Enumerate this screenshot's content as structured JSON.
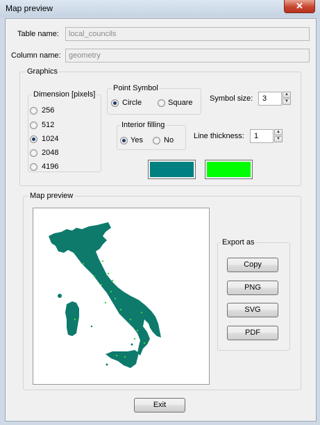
{
  "window": {
    "title": "Map preview",
    "close_glyph": "✕"
  },
  "table": {
    "label": "Table name:",
    "value": "local_councils"
  },
  "column": {
    "label": "Column name:",
    "value": "geometry"
  },
  "graphics": {
    "title": "Graphics",
    "dimension": {
      "title": "Dimension [pixels]",
      "options": [
        "256",
        "512",
        "1024",
        "2048",
        "4196"
      ],
      "selected": "1024"
    },
    "point_symbol": {
      "title": "Point Symbol",
      "options": [
        "Circle",
        "Square"
      ],
      "selected": "Circle"
    },
    "interior_filling": {
      "title": "Interior filling",
      "options": [
        "Yes",
        "No"
      ],
      "selected": "Yes"
    },
    "symbol_size": {
      "label": "Symbol size:",
      "value": "3"
    },
    "line_thickness": {
      "label": "Line thickness:",
      "value": "1"
    },
    "fill_color": "#008080",
    "line_color": "#00ff00"
  },
  "map_preview": {
    "title": "Map preview",
    "map_color": "#0d7a6c",
    "highlight_color": "#3bd83b",
    "icon": "map-of-italy"
  },
  "export": {
    "title": "Export as",
    "buttons": [
      "Copy",
      "PNG",
      "SVG",
      "PDF"
    ]
  },
  "exit_label": "Exit"
}
